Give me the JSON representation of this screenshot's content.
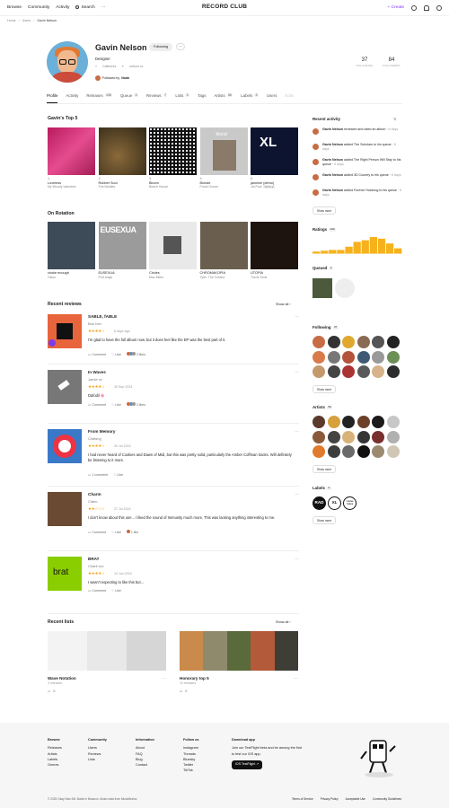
{
  "topnav": {
    "browse": "Browse",
    "community": "Community",
    "activity": "Activity",
    "search": "Search",
    "more": "···",
    "logo": "RECORD CLUB",
    "create": "+ Create"
  },
  "breadcrumb": {
    "home": "Home",
    "users": "Users",
    "current": "Gavin Nelson",
    "sep": "›"
  },
  "profile": {
    "name": "Gavin Nelson",
    "follow_label": "Following",
    "more": "···",
    "role": "Designer",
    "location": "California",
    "website": "nelson.cx",
    "followed_by_prefix": "Followed by",
    "followed_by": "Noah",
    "following_count": "37",
    "following_label": "FOLLOWING",
    "followers_count": "84",
    "followers_label": "FOLLOWERS"
  },
  "tabs": [
    {
      "label": "Profile"
    },
    {
      "label": "Activity"
    },
    {
      "label": "Releases",
      "count": "128"
    },
    {
      "label": "Queue",
      "count": "2"
    },
    {
      "label": "Reviews",
      "count": "7"
    },
    {
      "label": "Lists",
      "count": "2"
    },
    {
      "label": "Tags"
    },
    {
      "label": "Artists",
      "count": "56"
    },
    {
      "label": "Labels",
      "count": "3"
    },
    {
      "label": "Users"
    },
    {
      "label": "Edits"
    }
  ],
  "top5": {
    "title": "Gavin's Top 5",
    "items": [
      {
        "n": "1.",
        "title": "Loveless",
        "artist": "My Bloody Valentine",
        "color": "#d9477a"
      },
      {
        "n": "2.",
        "title": "Rubber Soul",
        "artist": "The Beatles",
        "color": "#5a4a2c"
      },
      {
        "n": "3.",
        "title": "Bloom",
        "artist": "Beach House",
        "color": "#111111"
      },
      {
        "n": "4.",
        "title": "Blonde",
        "artist": "Frank Ocean",
        "color": "#c9c9c9"
      },
      {
        "n": "5.",
        "title": "jasmine (demo)",
        "artist": "Jai Paul",
        "color": "#0d1430",
        "badge": "SINGLE"
      }
    ]
  },
  "rotation": {
    "title": "On Rotation",
    "items": [
      {
        "title": "choke enough",
        "artist": "Oklou",
        "color": "#3d4a58"
      },
      {
        "title": "EUSEXUA",
        "artist": "FKA twigs",
        "color": "#9b9b9b"
      },
      {
        "title": "Circles",
        "artist": "Mac Miller",
        "color": "#e9e9e9"
      },
      {
        "title": "CHROMAKOPIA",
        "artist": "Tyler, The Creator",
        "color": "#6a5f4e"
      },
      {
        "title": "UTOPIA",
        "artist": "Travis Scott",
        "color": "#1d1410"
      }
    ]
  },
  "reviews": {
    "title": "Recent reviews",
    "show_all": "Show all ›",
    "items": [
      {
        "title": "SABLE, fABLE",
        "artist": "Bon Iver",
        "stars": "★★★★☆",
        "date": "6 days ago",
        "body": "I'm glad to have the full album now, but it does feel like the EP was the best part of it.",
        "comment": "Comment",
        "like": "Like",
        "likes": "3 likes",
        "color": "#e8643c"
      },
      {
        "title": "In Waves",
        "artist": "Jamie xx",
        "stars": "★★★★☆",
        "date": "30 Sep 2024",
        "body": "Dafodil 🌸",
        "comment": "Comment",
        "like": "Like",
        "likes": "3 likes",
        "color": "#777"
      },
      {
        "title": "From Memory",
        "artist": "Clothing",
        "stars": "★★★★☆",
        "date": "30 Jul 2024",
        "body": "I had never heard of Cookies and Dawn of Midi, but this was pretty solid, particularly the Amber Coffman tracks. Will definitely be listening to it more.",
        "comment": "1 comment",
        "like": "Like",
        "likes": "",
        "color": "#3a78c8"
      },
      {
        "title": "Charm",
        "artist": "Clairo",
        "stars": "★★☆☆☆",
        "date": "27 Jul 2024",
        "body": "I don't know about this one... I liked the sound of Immunity much more. This was lacking anything interesting to me.",
        "comment": "Comment",
        "like": "Like",
        "likes": "1 like",
        "color": "#6b4a34"
      },
      {
        "title": "BRAT",
        "artist": "Charli xcx",
        "stars": "★★★★☆",
        "date": "10 Jun 2024",
        "body": "I wasn't expecting to like this but...",
        "comment": "Comment",
        "like": "Like",
        "likes": "",
        "color": "#8ace00",
        "cover_text": "brat"
      }
    ]
  },
  "lists": {
    "title": "Recent lists",
    "show_all": "Show all ›",
    "items": [
      {
        "title": "Wave Notation",
        "sub": "3 releases",
        "comments": "0",
        "colors": [
          "#f3f3f3",
          "#e8e8e8",
          "#d6d6d6"
        ]
      },
      {
        "title": "Honorary top 5",
        "sub": "10 releases",
        "comments": "0",
        "colors": [
          "#c98a4b",
          "#8f8a6c",
          "#5a6a3a",
          "#b35a3a",
          "#3e3e36"
        ]
      }
    ]
  },
  "sidebar": {
    "recent_activity": "Recent activity",
    "activity": [
      {
        "user": "Gavin Nelson",
        "text": "reviewed and rated an album",
        "time": "6 days"
      },
      {
        "user": "Gavin Nelson",
        "text": "added The Scholars to his queue",
        "time": "6 days"
      },
      {
        "user": "Gavin Nelson",
        "text": "added The Right Person Will Stay to his queue",
        "time": "6 days"
      },
      {
        "user": "Gavin Nelson",
        "text": "added 3D Country to his queue",
        "time": "6 days"
      },
      {
        "user": "Gavin Nelson",
        "text": "added Forever Howlong to his queue",
        "time": "6 days"
      }
    ],
    "show_more": "Show more",
    "ratings": "Ratings",
    "ratings_count": "446",
    "rating_bars": [
      2,
      3,
      4,
      4,
      8,
      14,
      16,
      20,
      18,
      12,
      6
    ],
    "queued": "Queued",
    "queued_count": "2",
    "following": "Following",
    "following_count": "37",
    "artists": "Artists",
    "artists_count": "56",
    "labels": "Labels",
    "labels_count": "3",
    "label_names": [
      "RAD",
      "XL",
      "YOUNG TURKS"
    ]
  },
  "footer": {
    "browse": {
      "h": "Browse",
      "items": [
        "Releases",
        "Artists",
        "Labels",
        "Genres"
      ]
    },
    "community": {
      "h": "Community",
      "items": [
        "Users",
        "Reviews",
        "Lists"
      ]
    },
    "information": {
      "h": "Information",
      "items": [
        "About",
        "FAQ",
        "Blog",
        "Contact"
      ]
    },
    "follow": {
      "h": "Follow us",
      "items": [
        "Instagram",
        "Threads",
        "Bluesky",
        "Twitter",
        "TikTok"
      ]
    },
    "app": {
      "h": "Download app",
      "text": "Join our TestFlight beta and be among the first to test our iOS app.",
      "button": "iOS TestFlight ↗"
    },
    "copyright": "© 2025 Okay Nice AB. Made in Brasovó. Music data from MusicBrainz.",
    "links": [
      "Terms of Service",
      "Privacy Policy",
      "Acceptable Use",
      "Community Guidelines"
    ]
  }
}
